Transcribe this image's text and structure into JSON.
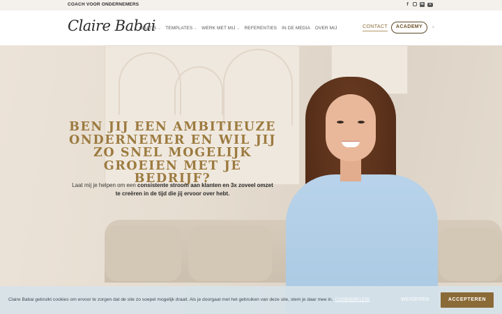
{
  "topbar": {
    "tagline": "COACH VOOR ONDERNEMERS",
    "social": [
      {
        "icon": "facebook-icon",
        "glyph": "f"
      },
      {
        "icon": "instagram-icon",
        "glyph": ""
      },
      {
        "icon": "linkedin-icon",
        "glyph": "in"
      },
      {
        "icon": "youtube-icon",
        "glyph": ""
      }
    ]
  },
  "header": {
    "logo": "Claire Babai",
    "nav": [
      {
        "label": "GRATIS",
        "dropdown": true
      },
      {
        "label": "TEMPLATES",
        "dropdown": true
      },
      {
        "label": "WERK MET MIJ",
        "dropdown": true
      },
      {
        "label": "REFERENTIES",
        "dropdown": false
      },
      {
        "label": "IN DE MEDIA",
        "dropdown": false
      },
      {
        "label": "OVER MIJ",
        "dropdown": false
      }
    ],
    "contact": "CONTACT",
    "academy": "ACADEMY",
    "more": "-"
  },
  "hero": {
    "headline": "Ben jij een ambitieuze ondernemer en wil jij zo snel mogelijk groeien met je bedrijf?",
    "sub_pre": "Laat mij je helpen om een ",
    "sub_bold": "consistente stroom aan klanten en 3x zoveel omzet te creëren in de tijd die jij ervoor over hebt.",
    "sub_post": ""
  },
  "cookie": {
    "message": "Claire Babai gebruikt cookies om ervoor te zorgen dat de site zo soepel mogelijk draait. Als je doorgaat met het gebruiken van deze site, stem je daar mee in.",
    "policy_link": "COOKIEBELEID",
    "decline": "WEIGEREN",
    "accept": "ACCEPTEREN"
  },
  "colors": {
    "accent_gold": "#9c7a3f",
    "button_brown": "#8a6a37",
    "cookie_bg": "#d6e2e8"
  }
}
